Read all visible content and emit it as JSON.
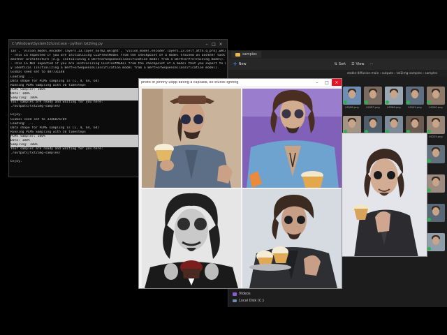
{
  "terminal": {
    "title": "C:\\Windows\\System32\\cmd.exe - python  txt2img.py",
    "lines": [
      "ias', 'vision_model.encoder.layers.13.layer_norm2.weight', 'vision_model.encoder.layers.23.self_attn.q_proj.weight']",
      "- This IS expected if you are initializing CLIPTextModel from the checkpoint of a model trained on another task or with",
      "another architecture (e.g. initializing a BertForSequenceClassification model from a BertForPreTraining model).",
      "- This IS NOT expected if you are initializing CLIPTextModel from the checkpoint of a model that you expect to be exactl",
      "y identical (initializing a BertForSequenceClassification model from a BertForSequenceClassification model).",
      "Global seed set to 487731148",
      "Loading: ...",
      "Data shape for PLMS sampling is (1, 4, 64, 64)",
      "Running PLMS Sampling with 50 timesteps",
      "PLMS Sampler: 100%",
      "Data: 100%",
      "Sampling: 100%",
      "Your samples are ready and waiting for you here:",
      "./outputs/txt2img-samples/",
      "",
      "Enjoy.",
      "Global seed set to 3346076709",
      "Loading: ...",
      "Data shape for PLMS sampling is (1, 4, 64, 64)",
      "Running PLMS Sampling with 50 timesteps",
      "PLMS Sampler: 100%",
      "Data: 100%",
      "Sampling: 100%",
      "Your samples are ready and waiting for you here:",
      "./outputs/txt2img-samples/",
      "",
      "Enjoy."
    ]
  },
  "explorer": {
    "tab_label": "samples",
    "toolbar": {
      "new": "New",
      "sort": "Sort",
      "view": "View"
    },
    "address": "stable-diffusion-main  ›  outputs  ›  txt2img-samples  ›  samples",
    "sidebar": [
      {
        "label": "Videos",
        "icon": "video-icon"
      },
      {
        "label": "Local Disk (C:)",
        "icon": "disk-icon"
      }
    ],
    "thumb_labels": [
      "00288.png",
      "00287.png",
      "00286.png",
      "00241.png",
      "00240.png",
      "00239.png",
      "00237.png",
      "00236.png",
      "00226.png",
      "00225.png",
      "00224.png"
    ],
    "thumb_colors": [
      "#6d8fb5",
      "#7a6b62",
      "#9aa7b3",
      "#5d6f80",
      "#8d7a6b",
      "#a39486",
      "#4f5e6c",
      "#7b8a96",
      "#6a5a50",
      "#99877a",
      "#5c6b77",
      "#8b98a4",
      "#7f6e64",
      "#b0a196",
      "#60707d",
      "#a0aebb",
      "#574b44",
      "#8a7d73",
      "#6f8190",
      "#9c8b80",
      "#657482",
      "#8e9daa",
      "#74665d",
      "#aa9b90",
      "#596877",
      "#97a5b2",
      "#6b5d54",
      "#a08f84",
      "#637383",
      "#8f9eab"
    ]
  },
  "viewer": {
    "title": "photo of Johnny Depp eating a cupcake, 8k studio lighting"
  }
}
